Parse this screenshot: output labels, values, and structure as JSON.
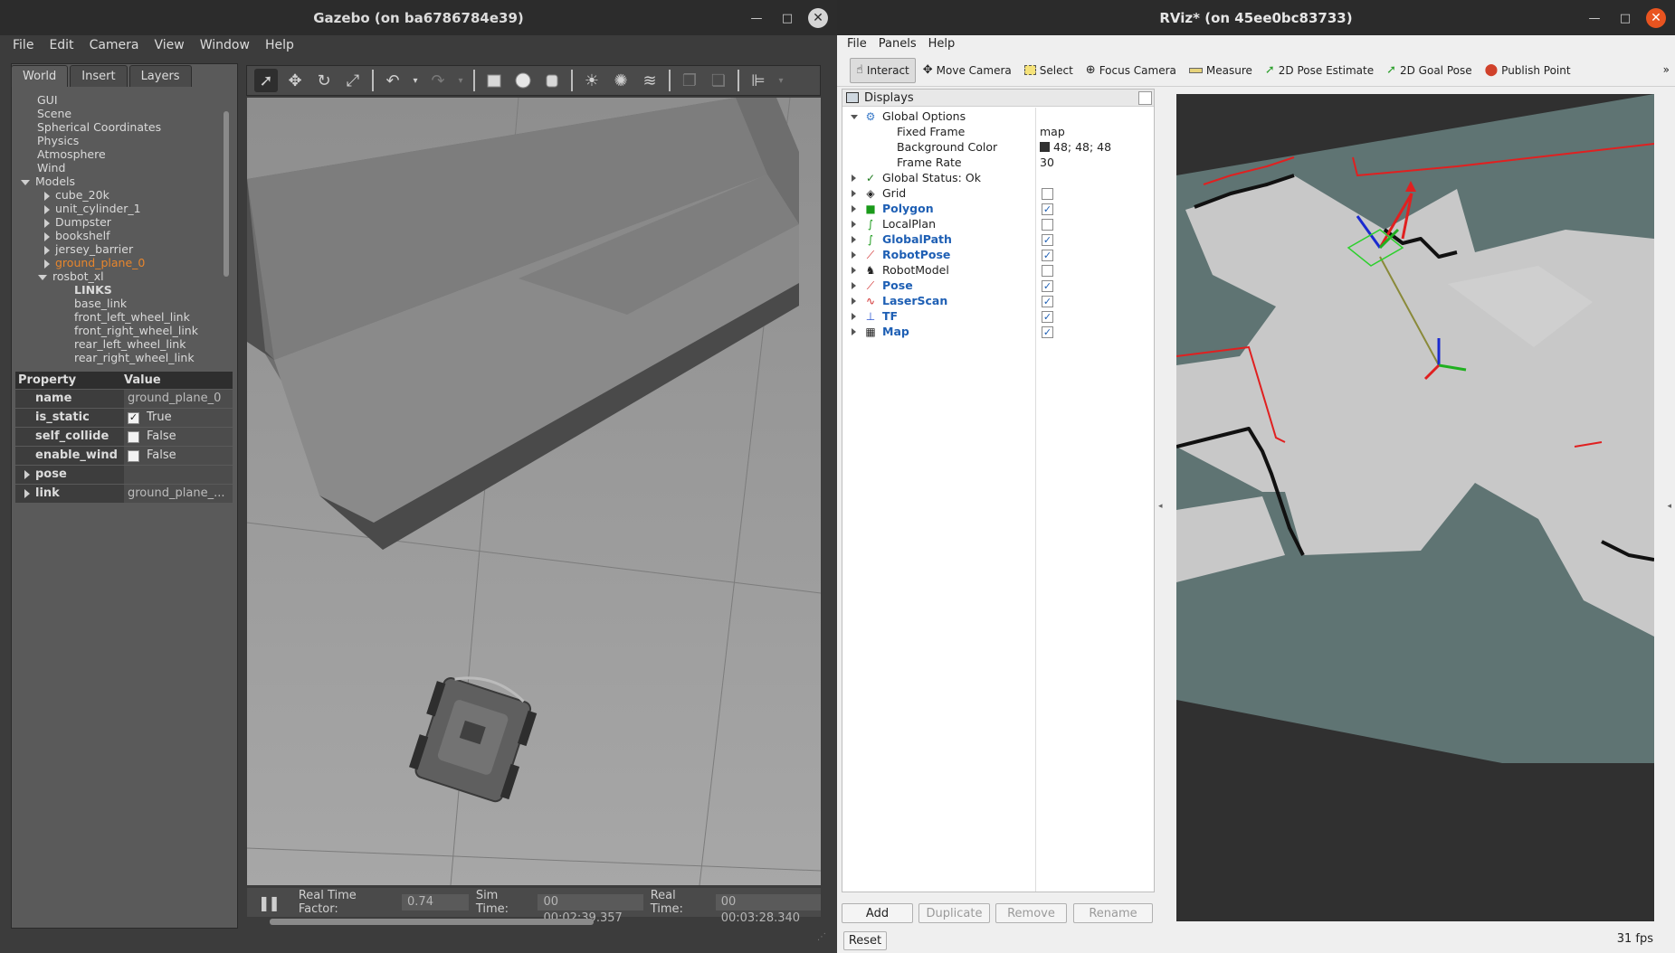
{
  "gazebo": {
    "title": "Gazebo (on ba6786784e39)",
    "menu": [
      "File",
      "Edit",
      "Camera",
      "View",
      "Window",
      "Help"
    ],
    "tabs": [
      "World",
      "Insert",
      "Layers"
    ],
    "tree": [
      {
        "label": "GUI"
      },
      {
        "label": "Scene"
      },
      {
        "label": "Spherical Coordinates"
      },
      {
        "label": "Physics"
      },
      {
        "label": "Atmosphere"
      },
      {
        "label": "Wind"
      },
      {
        "label": "Models"
      },
      {
        "label": "cube_20k"
      },
      {
        "label": "unit_cylinder_1"
      },
      {
        "label": "Dumpster"
      },
      {
        "label": "bookshelf"
      },
      {
        "label": "jersey_barrier"
      },
      {
        "label": "ground_plane_0"
      },
      {
        "label": "rosbot_xl"
      },
      {
        "label": "LINKS"
      },
      {
        "label": "base_link"
      },
      {
        "label": "front_left_wheel_link"
      },
      {
        "label": "front_right_wheel_link"
      },
      {
        "label": "rear_left_wheel_link"
      },
      {
        "label": "rear_right_wheel_link"
      }
    ],
    "selected_color": "#e8862c",
    "properties": {
      "header": [
        "Property",
        "Value"
      ],
      "rows": [
        {
          "name": "name",
          "value": "ground_plane_0"
        },
        {
          "name": "is_static",
          "value": "True",
          "checked": true
        },
        {
          "name": "self_collide",
          "value": "False",
          "checked": false
        },
        {
          "name": "enable_wind",
          "value": "False",
          "checked": false
        },
        {
          "name": "pose",
          "value": ""
        },
        {
          "name": "link",
          "value": "ground_plane_..."
        }
      ]
    },
    "status": {
      "rtf_label": "Real Time Factor:",
      "rtf_value": "0.74",
      "sim_label": "Sim Time:",
      "sim_value": "00 00:02:39.357",
      "real_label": "Real Time:",
      "real_value": "00 00:03:28.340"
    }
  },
  "rviz": {
    "title": "RViz* (on 45ee0bc83733)",
    "menu": [
      "File",
      "Panels",
      "Help"
    ],
    "tools": [
      "Interact",
      "Move Camera",
      "Select",
      "Focus Camera",
      "Measure",
      "2D Pose Estimate",
      "2D Goal Pose",
      "Publish Point"
    ],
    "displays_title": "Displays",
    "global_options": {
      "label": "Global Options",
      "fixed_frame_label": "Fixed Frame",
      "fixed_frame_value": "map",
      "bg_label": "Background Color",
      "bg_value": "48; 48; 48",
      "frame_rate_label": "Frame Rate",
      "frame_rate_value": "30"
    },
    "global_status": "Global Status: Ok",
    "displays": [
      {
        "name": "Grid",
        "checked": false,
        "bold": false
      },
      {
        "name": "Polygon",
        "checked": true,
        "bold": true
      },
      {
        "name": "LocalPlan",
        "checked": false,
        "bold": false
      },
      {
        "name": "GlobalPath",
        "checked": true,
        "bold": true
      },
      {
        "name": "RobotPose",
        "checked": true,
        "bold": true
      },
      {
        "name": "RobotModel",
        "checked": false,
        "bold": false
      },
      {
        "name": "Pose",
        "checked": true,
        "bold": true
      },
      {
        "name": "LaserScan",
        "checked": true,
        "bold": true
      },
      {
        "name": "TF",
        "checked": true,
        "bold": true
      },
      {
        "name": "Map",
        "checked": true,
        "bold": true
      }
    ],
    "buttons": {
      "add": "Add",
      "duplicate": "Duplicate",
      "remove": "Remove",
      "rename": "Rename",
      "reset": "Reset"
    },
    "fps": "31 fps"
  }
}
